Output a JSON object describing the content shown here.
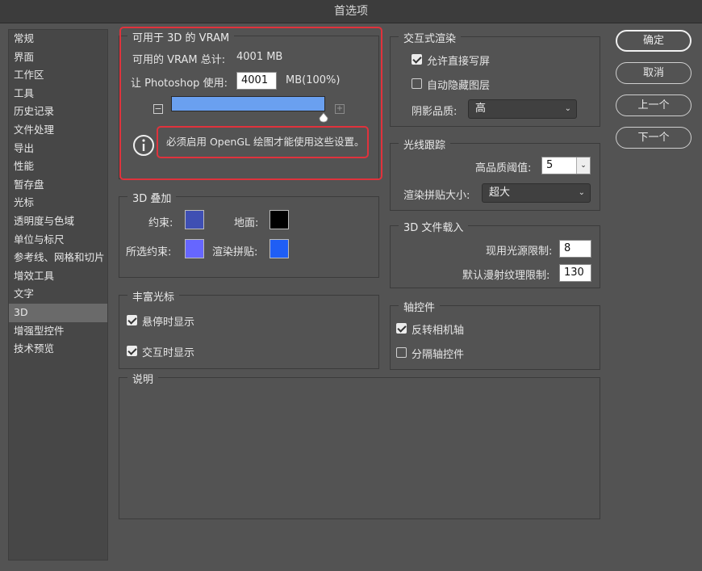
{
  "window": {
    "title": "首选项"
  },
  "sidebar": {
    "items": [
      {
        "label": "常规"
      },
      {
        "label": "界面"
      },
      {
        "label": "工作区"
      },
      {
        "label": "工具"
      },
      {
        "label": "历史记录"
      },
      {
        "label": "文件处理"
      },
      {
        "label": "导出"
      },
      {
        "label": "性能"
      },
      {
        "label": "暂存盘"
      },
      {
        "label": "光标"
      },
      {
        "label": "透明度与色域"
      },
      {
        "label": "单位与标尺"
      },
      {
        "label": "参考线、网格和切片"
      },
      {
        "label": "增效工具"
      },
      {
        "label": "文字"
      },
      {
        "label": "3D",
        "selected": true
      },
      {
        "label": "增强型控件"
      },
      {
        "label": "技术预览"
      }
    ]
  },
  "vram": {
    "title": "可用于 3D 的 VRAM",
    "total_label": "可用的 VRAM 总计:",
    "total_value": "4001 MB",
    "use_label": "让 Photoshop 使用:",
    "use_value": "4001",
    "use_suffix": "MB(100%)",
    "slider_fraction": 1.0,
    "minus_symbol": "−",
    "plus_symbol": "+",
    "info_text": "必须启用 OpenGL 绘图才能使用这些设置。"
  },
  "overlay3d": {
    "title": "3D 叠加",
    "constraint_label": "约束:",
    "ground_label": "地面:",
    "selected_constraint_label": "所选约束:",
    "render_tiles_label": "渲染拼贴:",
    "colors": {
      "constraint": "#3f4fb3",
      "ground": "#000000",
      "selected_constraint": "#6666ff",
      "render_tiles": "#1f5ef5"
    }
  },
  "rich_cursor": {
    "title": "丰富光标",
    "hover_label": "悬停时显示",
    "hover_checked": true,
    "interact_label": "交互时显示",
    "interact_checked": true
  },
  "description": {
    "title": "说明"
  },
  "interactive_render": {
    "title": "交互式渲染",
    "direct_label": "允许直接写屏",
    "direct_checked": true,
    "autohide_label": "自动隐藏图层",
    "autohide_checked": false,
    "shadow_label": "阴影品质:",
    "shadow_value": "高"
  },
  "ray_trace": {
    "title": "光线跟踪",
    "threshold_label": "高品质阈值:",
    "threshold_value": "5",
    "tile_size_label": "渲染拼贴大小:",
    "tile_size_value": "超大"
  },
  "file_load": {
    "title": "3D 文件载入",
    "light_label": "现用光源限制:",
    "light_value": "8",
    "texture_label": "默认漫射纹理限制:",
    "texture_value": "130"
  },
  "axis": {
    "title": "轴控件",
    "invert_label": "反转相机轴",
    "invert_checked": true,
    "separate_label": "分隔轴控件",
    "separate_checked": false
  },
  "buttons": {
    "ok": "确定",
    "cancel": "取消",
    "prev": "上一个",
    "next": "下一个"
  },
  "accent_colors": {
    "highlight_border": "#e0323c",
    "slider_fill": "#6aa0f0"
  }
}
